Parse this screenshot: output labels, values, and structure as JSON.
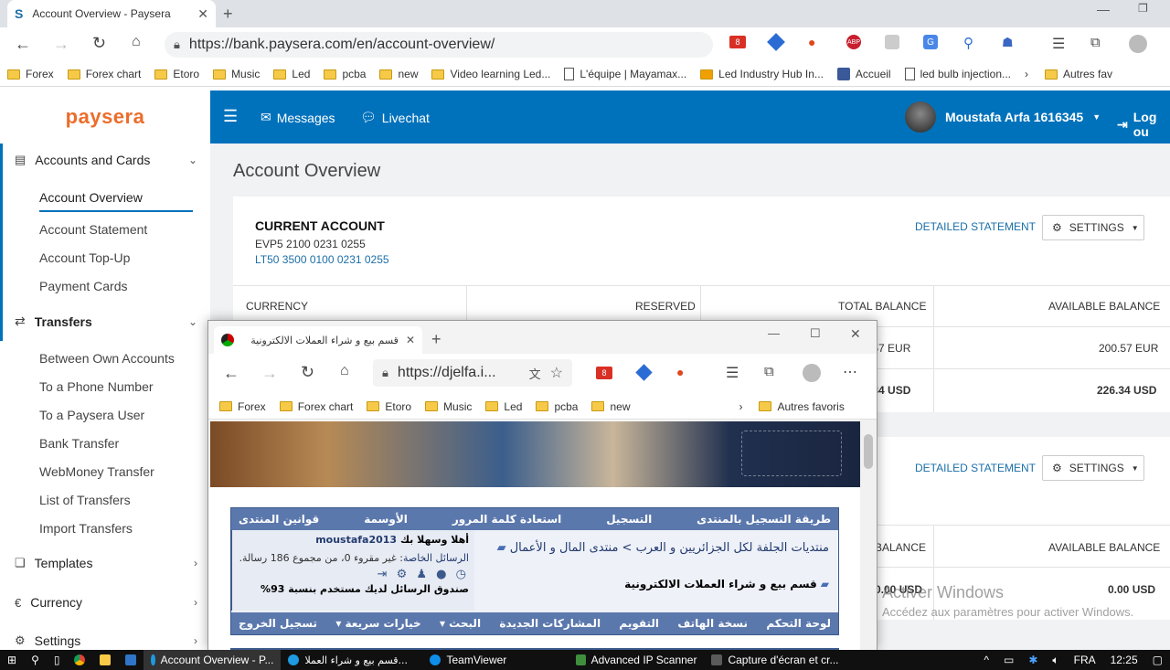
{
  "browser": {
    "tab_title": "Account Overview - Paysera",
    "url": "https://bank.paysera.com/en/account-overview/",
    "bookmarks": [
      "Forex",
      "Forex chart",
      "Etoro",
      "Music",
      "Led",
      "pcba",
      "new",
      "Video learning Led...",
      "L'équipe | Mayamax...",
      "Led Industry Hub In...",
      "Accueil",
      "led bulb injection...",
      "Autres fav"
    ]
  },
  "paysera": {
    "logo": "paysera",
    "topbar": {
      "messages": "Messages",
      "livechat": "Livechat",
      "user": "Moustafa Arfa 1616345",
      "logout": "Log ou"
    },
    "sidebar": {
      "accounts_cards": "Accounts and Cards",
      "account_overview": "Account Overview",
      "account_statement": "Account Statement",
      "account_topup": "Account Top-Up",
      "payment_cards": "Payment Cards",
      "transfers": "Transfers",
      "between_own": "Between Own Accounts",
      "to_phone": "To a Phone Number",
      "to_paysera_user": "To a Paysera User",
      "bank_transfer": "Bank Transfer",
      "webmoney": "WebMoney Transfer",
      "list_transfers": "List of Transfers",
      "import_transfers": "Import Transfers",
      "templates": "Templates",
      "currency": "Currency",
      "settings": "Settings"
    },
    "page_title": "Account Overview",
    "card1": {
      "title": "CURRENT ACCOUNT",
      "evp": "EVP5 2100 0231 0255",
      "lt": "LT50 3500 0100 0231 0255",
      "detailed": "DETAILED STATEMENT",
      "settings": "SETTINGS",
      "col_currency": "CURRENCY",
      "col_reserved": "RESERVED",
      "col_total": "TOTAL BALANCE",
      "col_available": "AVAILABLE BALANCE",
      "row1_total": "200.57 EUR",
      "row1_available": "200.57 EUR",
      "row2_total": "226.34 USD",
      "row2_available": "226.34 USD"
    },
    "card2": {
      "detailed": "DETAILED STATEMENT",
      "settings": "SETTINGS",
      "col_total": "BALANCE",
      "col_available": "AVAILABLE BALANCE",
      "row_total": "0.00 USD",
      "row_available": "0.00 USD"
    }
  },
  "edge": {
    "tab_title": "قسم بيع و شراء العملات الالكترونية",
    "url": "https://djelfa.i...",
    "bookmarks": [
      "Forex",
      "Forex chart",
      "Etoro",
      "Music",
      "Led",
      "pcba",
      "new"
    ],
    "other_favorites": "Autres favoris",
    "forum": {
      "top_links": [
        "طريقة التسجيل بالمنتدى",
        "التسجيل",
        "استعادة كلمة المرور",
        "الأوسمة",
        "قوانين المنتدى"
      ],
      "welcome": "أهلا وسهلا بك",
      "username": "moustafa2013",
      "pm_label": "الرسائل الخاصة",
      "pm_text": "غير مقروء 0، من مجموع 186 رسالة.",
      "inbox": "صندوق الرسائل لديك مستخدم بنسبة 93%",
      "breadcrumb": "منتديات الجلفة لكل الجزائريين و العرب > منتدى المال و الأعمال",
      "section": "قسم بيع و شراء العملات الالكترونية",
      "bottom_links": [
        "لوحة التحكم",
        "نسخة الهاتف",
        "التقويم",
        "المشاركات الجديدة",
        "البحث ▾",
        "خيارات سريعة ▾",
        "تسجيل الخروج"
      ]
    }
  },
  "watermark": {
    "line1": "Activer Windows",
    "line2": "Accédez aux paramètres pour activer Windows."
  },
  "taskbar": {
    "items": [
      "Account Overview - P...",
      "قسم بيع و شراء العملا...",
      "TeamViewer",
      "Advanced IP Scanner",
      "Capture d'écran et cr..."
    ],
    "lang": "FRA",
    "time": "12:25"
  }
}
